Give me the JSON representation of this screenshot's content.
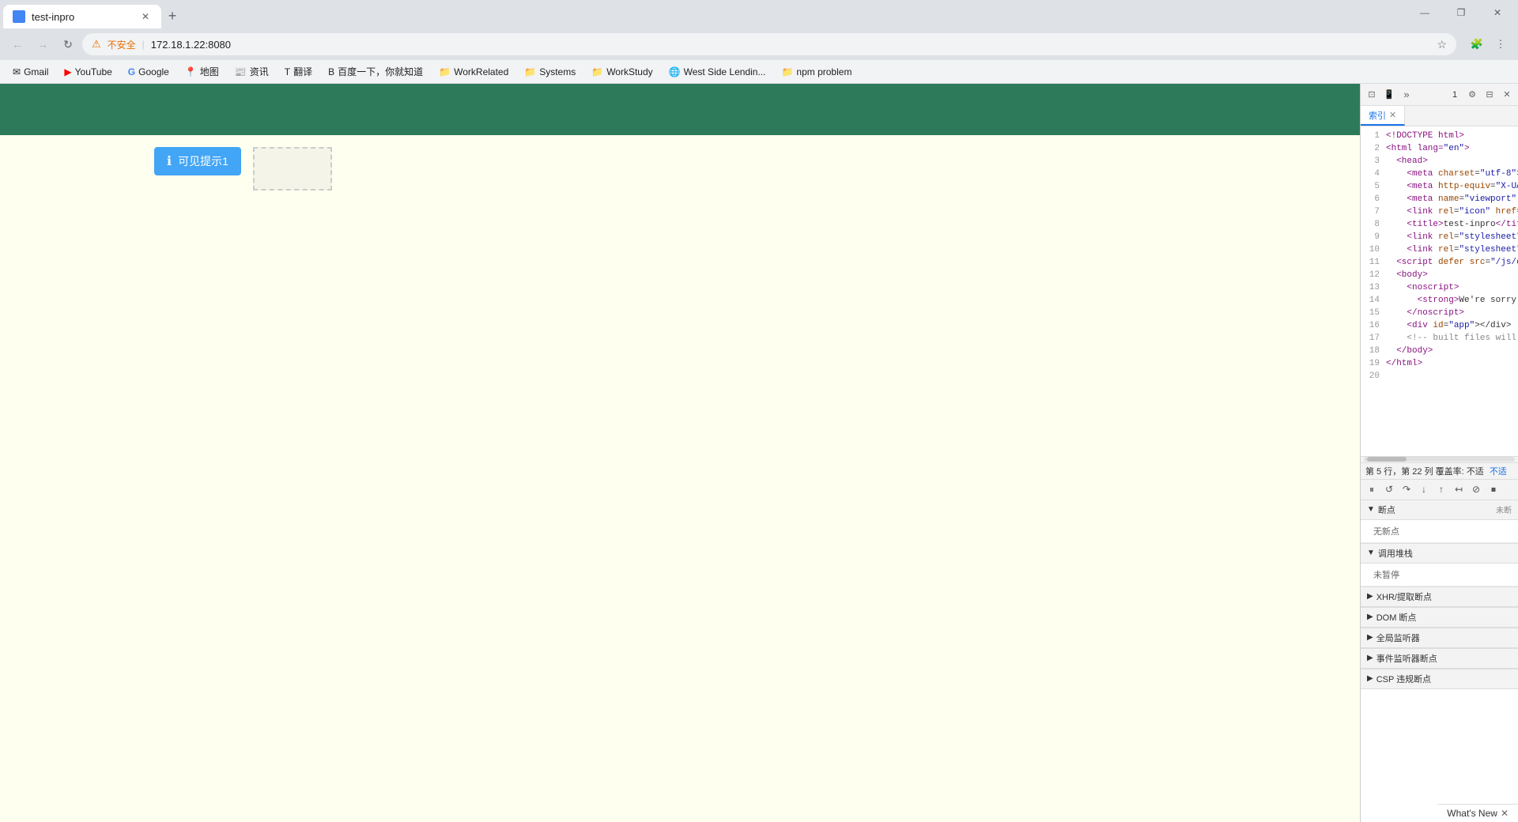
{
  "browser": {
    "tab": {
      "title": "test-inpro",
      "favicon_color": "#4285f4"
    },
    "new_tab_label": "+",
    "window_controls": {
      "minimize": "—",
      "maximize": "❐",
      "close": "✕"
    },
    "address_bar": {
      "back_icon": "←",
      "forward_icon": "→",
      "refresh_icon": "↻",
      "warning_icon": "⚠",
      "url": "172.18.1.22:8080",
      "security_label": "不安全",
      "bookmark_icon": "☆",
      "extensions_icon": "🧩",
      "menu_icon": "⋮"
    },
    "bookmarks": [
      {
        "label": "Gmail",
        "icon": "✉"
      },
      {
        "label": "YouTube",
        "icon": "▶"
      },
      {
        "label": "Google",
        "icon": "G"
      },
      {
        "label": "地图",
        "icon": "📍"
      },
      {
        "label": "资讯",
        "icon": "📰"
      },
      {
        "label": "翻译",
        "icon": "T"
      },
      {
        "label": "百度一下，你就知道",
        "icon": "B"
      },
      {
        "label": "WorkRelated",
        "icon": "📁"
      },
      {
        "label": "Systems",
        "icon": "📁"
      },
      {
        "label": "WorkStudy",
        "icon": "📁"
      },
      {
        "label": "West Side Lendin...",
        "icon": "🌐"
      },
      {
        "label": "npm problem",
        "icon": "📁"
      }
    ]
  },
  "page": {
    "header_color": "#2d7a5a",
    "tooltip_button": {
      "icon": "ℹ",
      "label": "可见提示1"
    },
    "background_color": "#fffff0"
  },
  "devtools": {
    "tabs": [
      {
        "label": "索引",
        "active": true
      }
    ],
    "toolbar_icons": {
      "inspect": "⊡",
      "device": "📱",
      "more": "»",
      "panel_num": "1",
      "settings": "⚙",
      "dock": "⊟",
      "close": "✕"
    },
    "code_lines": [
      {
        "num": 1,
        "content": "<!DOCTYPE html>"
      },
      {
        "num": 2,
        "content": "<html lang=\"en\">"
      },
      {
        "num": 3,
        "content": "  <head>"
      },
      {
        "num": 4,
        "content": "    <meta charset=\"utf-8\">"
      },
      {
        "num": 5,
        "content": "    <meta http-equiv=\"X-UA-C"
      },
      {
        "num": 6,
        "content": "    <meta name=\"viewport\" co"
      },
      {
        "num": 7,
        "content": "    <link rel=\"icon\" href=\"/"
      },
      {
        "num": 8,
        "content": "    <title>test-inpro</title>"
      },
      {
        "num": 9,
        "content": "    <link rel=\"stylesheet\" h"
      },
      {
        "num": 10,
        "content": "    <link rel=\"stylesheet\" h"
      },
      {
        "num": 11,
        "content": "  <script defer src=\"/js/chu"
      },
      {
        "num": 12,
        "content": "  <body>"
      },
      {
        "num": 13,
        "content": "    <noscript>"
      },
      {
        "num": 14,
        "content": "      <strong>We're sorry bu"
      },
      {
        "num": 15,
        "content": "    </noscript>"
      },
      {
        "num": 16,
        "content": "    <div id=\"app\"></div>"
      },
      {
        "num": 17,
        "content": "    <!-- built files will be"
      },
      {
        "num": 18,
        "content": "  </body>"
      },
      {
        "num": 19,
        "content": "</html>"
      },
      {
        "num": 20,
        "content": ""
      }
    ],
    "status_bar": {
      "text": "第 5 行，第 22 列  覆盖率: 不适"
    },
    "debugger_controls": {
      "pause": "⏸",
      "resume": "↺",
      "step_over": "↷",
      "step_into": "↓",
      "step_out": "↑",
      "step_back": "↤",
      "deactivate": "⊘",
      "stop": "⏹"
    },
    "sections": {
      "breakpoints": {
        "label": "断点",
        "badge": "未断",
        "content": "无新点"
      },
      "call_stack": {
        "label": "调用堆栈",
        "content": "未暂停"
      },
      "xhr": {
        "label": "XHR/提取断点"
      },
      "dom": {
        "label": "DOM 断点"
      },
      "global_listeners": {
        "label": "全局监听器"
      },
      "event_listeners": {
        "label": "事件监听器断点"
      },
      "csp_violations": {
        "label": "CSP 违规断点"
      }
    },
    "whats_new": {
      "label": "What's New",
      "close": "✕"
    }
  }
}
